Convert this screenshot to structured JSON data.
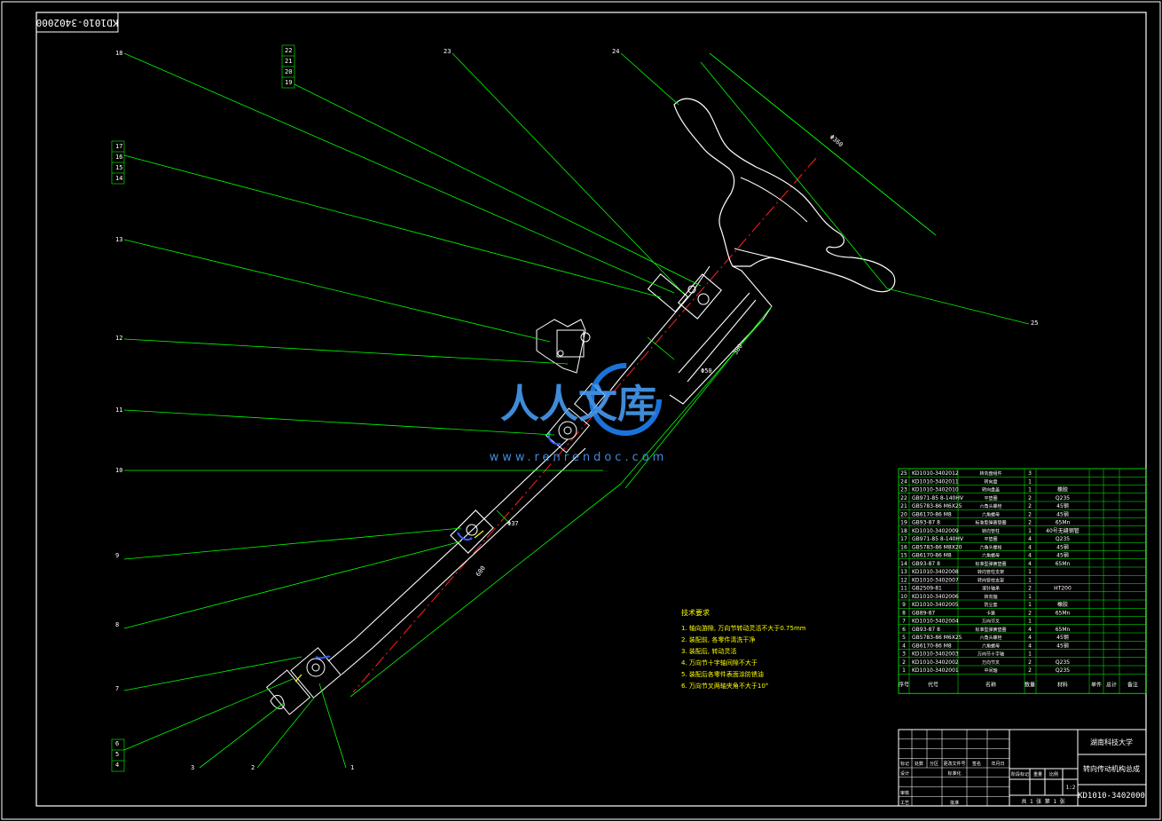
{
  "drawing_code_rotated": "KD1010-3402000",
  "callouts": [
    "1",
    "2",
    "3",
    "4",
    "5",
    "6",
    "7",
    "8",
    "9",
    "10",
    "11",
    "12",
    "13",
    "14",
    "15",
    "16",
    "17",
    "18",
    "19",
    "20",
    "21",
    "22",
    "23",
    "24",
    "25"
  ],
  "dimensions": [
    "Φ360",
    "380",
    "Φ50",
    "Φ37",
    "600"
  ],
  "watermark": {
    "text": "人人文库",
    "url": "www.renrendoc.com"
  },
  "tech_notes": {
    "title": "技术要求",
    "items": [
      "1. 轴向游隙, 万向节转动灵活不大于0.75mm",
      "2. 装配前, 各零件清洗干净",
      "3. 装配后, 转动灵活",
      "4. 万向节十字轴间隙不大于",
      "5. 装配后各零件表面涂防锈油",
      "6. 万向节叉两轴夹角不大于10°"
    ]
  },
  "bom": [
    {
      "no": "25",
      "code": "KD1010-3402012",
      "name": "转向盘组件",
      "qty": "3",
      "mat": ""
    },
    {
      "no": "24",
      "code": "KD1010-3402011",
      "name": "转向盘",
      "qty": "1",
      "mat": ""
    },
    {
      "no": "23",
      "code": "KD1010-3402010",
      "name": "转向盘盖",
      "qty": "1",
      "mat": "橡胶"
    },
    {
      "no": "22",
      "code": "GB971-85 8-140HV",
      "name": "平垫圈",
      "qty": "2",
      "mat": "Q235"
    },
    {
      "no": "21",
      "code": "GB5783-86 M6X25",
      "name": "六角头螺栓",
      "qty": "2",
      "mat": "45钢"
    },
    {
      "no": "20",
      "code": "GB6170-86 M8",
      "name": "六角螺母",
      "qty": "2",
      "mat": "45钢"
    },
    {
      "no": "19",
      "code": "GB93-87 8",
      "name": "标准型弹簧垫圈",
      "qty": "2",
      "mat": "65Mn"
    },
    {
      "no": "18",
      "code": "KD1010-3402009",
      "name": "转向管柱",
      "qty": "1",
      "mat": "40号无缝钢管"
    },
    {
      "no": "17",
      "code": "GB971-85 8-140HV",
      "name": "平垫圈",
      "qty": "4",
      "mat": "Q235"
    },
    {
      "no": "16",
      "code": "GB5783-86 M8X20",
      "name": "六角头螺栓",
      "qty": "4",
      "mat": "45钢"
    },
    {
      "no": "15",
      "code": "GB6170-86 M8",
      "name": "六角螺母",
      "qty": "4",
      "mat": "45钢"
    },
    {
      "no": "14",
      "code": "GB93-87 8",
      "name": "标准型弹簧垫圈",
      "qty": "4",
      "mat": "65Mn"
    },
    {
      "no": "13",
      "code": "KD1010-3402008",
      "name": "转向管柱支架",
      "qty": "1",
      "mat": ""
    },
    {
      "no": "12",
      "code": "KD1010-3402007",
      "name": "转向管柱支架",
      "qty": "1",
      "mat": ""
    },
    {
      "no": "11",
      "code": "GB2509-81",
      "name": "滚针轴承",
      "qty": "2",
      "mat": "HT200"
    },
    {
      "no": "10",
      "code": "KD1010-3402006",
      "name": "转向轴",
      "qty": "1",
      "mat": ""
    },
    {
      "no": "9",
      "code": "KD1010-3402005",
      "name": "防尘套",
      "qty": "1",
      "mat": "橡胶"
    },
    {
      "no": "8",
      "code": "GB89-87",
      "name": "卡簧",
      "qty": "2",
      "mat": "65Mn"
    },
    {
      "no": "7",
      "code": "KD1010-3402004",
      "name": "万向节叉",
      "qty": "1",
      "mat": ""
    },
    {
      "no": "6",
      "code": "GB93-87 8",
      "name": "标准型弹簧垫圈",
      "qty": "4",
      "mat": "65Mn"
    },
    {
      "no": "5",
      "code": "GB5783-86 M6X25",
      "name": "六角头螺栓",
      "qty": "4",
      "mat": "45钢"
    },
    {
      "no": "4",
      "code": "GB6170-86 M8",
      "name": "六角螺母",
      "qty": "4",
      "mat": "45钢"
    },
    {
      "no": "3",
      "code": "KD1010-3402003",
      "name": "万向节十字轴",
      "qty": "1",
      "mat": ""
    },
    {
      "no": "2",
      "code": "KD1010-3402002",
      "name": "万向节叉",
      "qty": "2",
      "mat": "Q235"
    },
    {
      "no": "1",
      "code": "KD1010-3402001",
      "name": "中间轴",
      "qty": "2",
      "mat": "Q235"
    }
  ],
  "bom_header": {
    "no": "序号",
    "code": "代号",
    "name": "名称",
    "qty": "数量",
    "mat": "材料",
    "unit_w": "单件",
    "total_w": "总计",
    "weight": "重量",
    "note": "备注"
  },
  "title_block": {
    "school": "湖南科技大学",
    "title": "转向传动机构总成",
    "drawing_no": "KD1010-3402000",
    "scale": "1:2",
    "labels": [
      "标记",
      "处数",
      "分区",
      "更改文件号",
      "签名",
      "年月日",
      "设计",
      "标准化",
      "审核",
      "工艺",
      "批准",
      "阶段标记",
      "重量",
      "比例"
    ],
    "sheet": "共 1 张 第 1 张"
  }
}
